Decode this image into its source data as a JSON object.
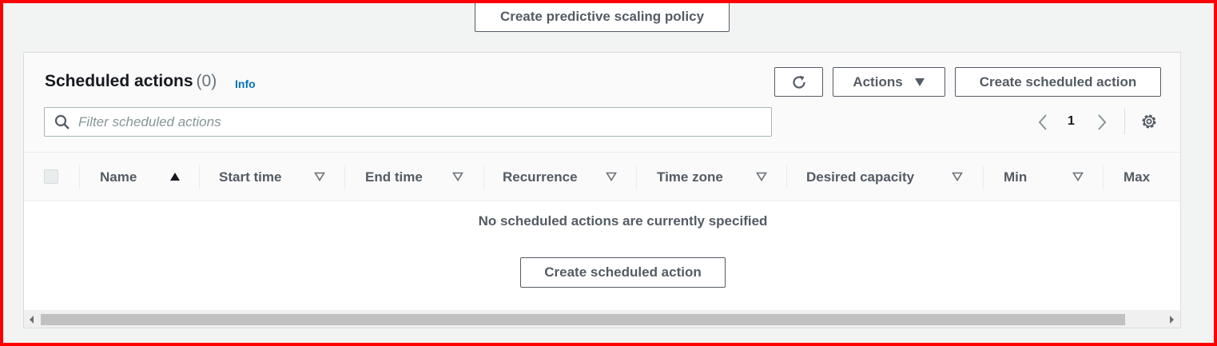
{
  "top": {
    "create_predictive_label": "Create predictive scaling policy"
  },
  "panel": {
    "title": "Scheduled actions",
    "count": "(0)",
    "info_link": "Info",
    "actions_label": "Actions",
    "create_label": "Create scheduled action",
    "search_placeholder": "Filter scheduled actions",
    "search_value": "",
    "page_number": "1"
  },
  "table": {
    "columns": [
      {
        "label": "Name",
        "sort": "ascending"
      },
      {
        "label": "Start time",
        "sort": "none"
      },
      {
        "label": "End time",
        "sort": "none"
      },
      {
        "label": "Recurrence",
        "sort": "none"
      },
      {
        "label": "Time zone",
        "sort": "none"
      },
      {
        "label": "Desired capacity",
        "sort": "none"
      },
      {
        "label": "Min",
        "sort": "none"
      },
      {
        "label": "Max",
        "sort": "none"
      }
    ],
    "rows": [],
    "empty_message": "No scheduled actions are currently specified",
    "empty_create_label": "Create scheduled action"
  },
  "icons": {
    "search": "search-icon",
    "refresh": "refresh-icon",
    "actions_caret": "caret-down-icon",
    "prev": "chevron-left-icon",
    "next": "chevron-right-icon",
    "settings": "gear-icon",
    "sort_asc": "sort-ascending-icon",
    "sort_none": "sort-descending-outline-icon"
  },
  "colors": {
    "link": "#0073bb",
    "text": "#16191f",
    "muted": "#545b64",
    "page_bg": "#f2f3f3",
    "border_highlight": "#ff0000"
  }
}
